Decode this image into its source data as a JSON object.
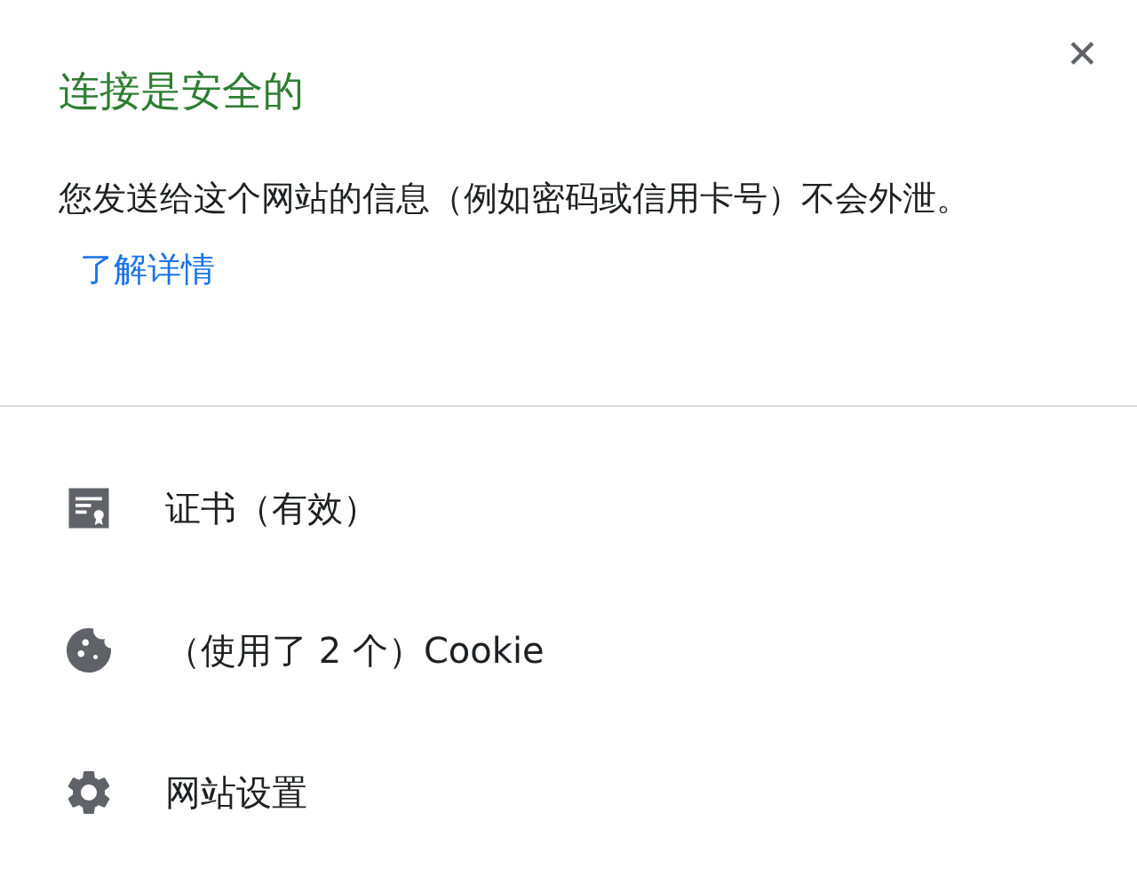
{
  "header": {
    "title": "连接是安全的",
    "close": "✕"
  },
  "message": {
    "text": "您发送给这个网站的信息（例如密码或信用卡号）不会外泄。",
    "link": "了解详情"
  },
  "items": [
    {
      "kind": "certificate",
      "label": "证书（有效）"
    },
    {
      "kind": "cookie",
      "label": "（使用了 2 个）Cookie"
    },
    {
      "kind": "settings",
      "label": "网站设置"
    }
  ]
}
